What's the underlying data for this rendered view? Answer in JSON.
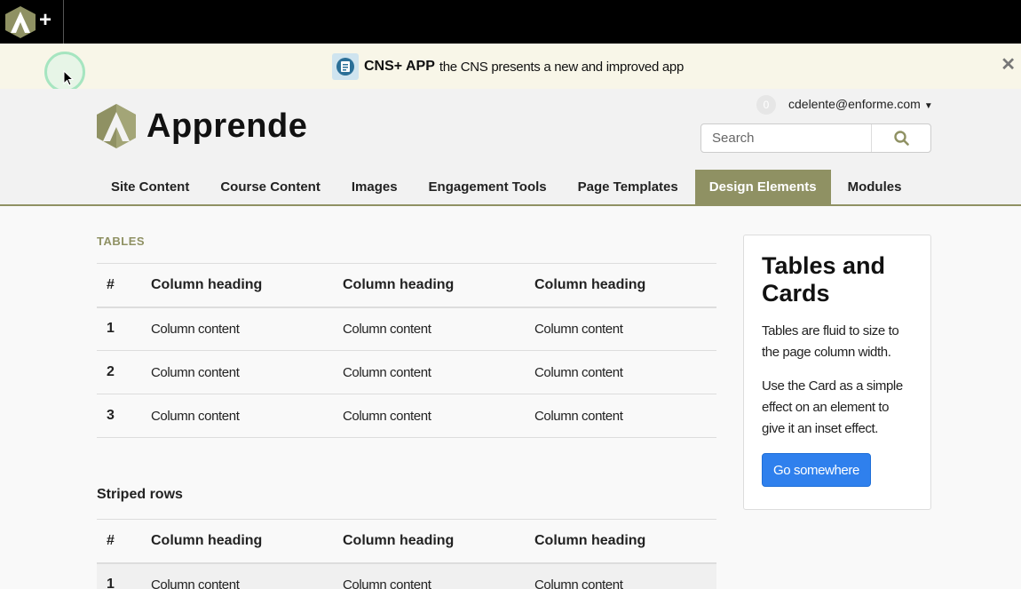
{
  "topbar": {
    "plus": "+"
  },
  "announcement": {
    "title": "CNS+ APP",
    "message": "the CNS presents a new and improved app",
    "close": "✕"
  },
  "header": {
    "brand": "Apprende",
    "notification_count": "0",
    "user_email": "cdelente@enforme.com",
    "search_placeholder": "Search"
  },
  "nav": {
    "tabs": [
      {
        "label": "Site Content"
      },
      {
        "label": "Course Content"
      },
      {
        "label": "Images"
      },
      {
        "label": "Engagement Tools"
      },
      {
        "label": "Page Templates"
      },
      {
        "label": "Design Elements"
      },
      {
        "label": "Modules"
      }
    ],
    "active_index": 5
  },
  "main": {
    "section_label": "TABLES",
    "table1": {
      "headers": [
        "#",
        "Column heading",
        "Column heading",
        "Column heading"
      ],
      "rows": [
        [
          "1",
          "Column content",
          "Column content",
          "Column content"
        ],
        [
          "2",
          "Column content",
          "Column content",
          "Column content"
        ],
        [
          "3",
          "Column content",
          "Column content",
          "Column content"
        ]
      ]
    },
    "striped_title": "Striped rows",
    "table2": {
      "headers": [
        "#",
        "Column heading",
        "Column heading",
        "Column heading"
      ],
      "rows": [
        [
          "1",
          "Column content",
          "Column content",
          "Column content"
        ]
      ]
    }
  },
  "card": {
    "title": "Tables and Cards",
    "p1": "Tables are fluid to size to the page column width.",
    "p2": "Use the Card as a simple effect on an element to give it an inset effect.",
    "button": "Go somewhere"
  },
  "colors": {
    "accent": "#8f9163",
    "button_blue": "#2f80ed",
    "announcement_bg": "#f8f6e8"
  }
}
